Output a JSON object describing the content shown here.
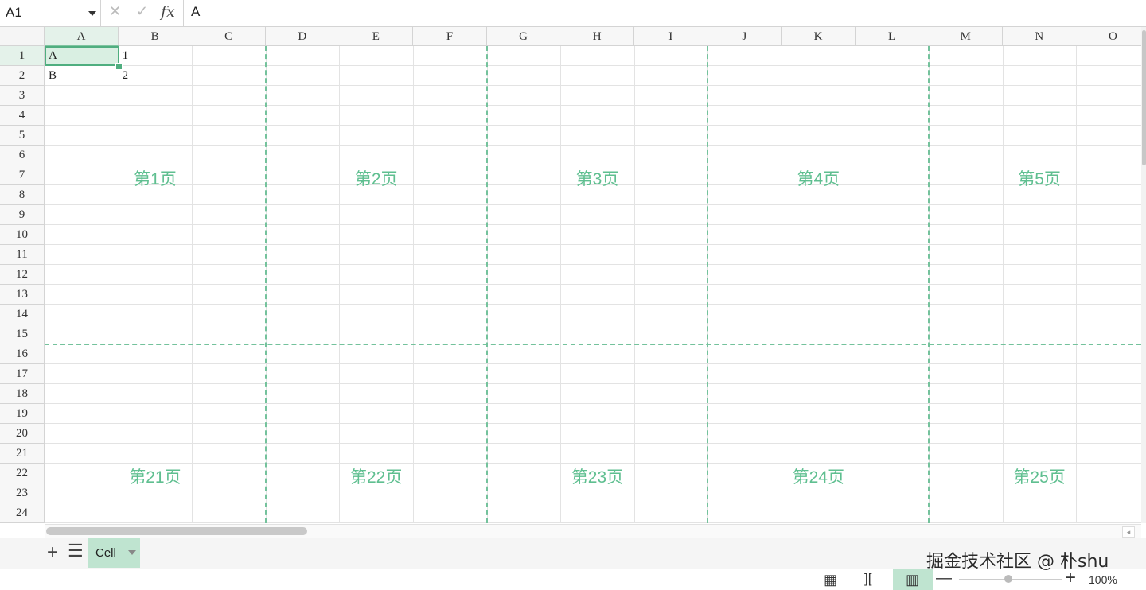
{
  "formula_bar": {
    "name_box": "A1",
    "cancel_glyph": "✕",
    "confirm_glyph": "✓",
    "fx_label": "fx",
    "value": "A"
  },
  "sheet": {
    "columns": [
      "A",
      "B",
      "C",
      "D",
      "E",
      "F",
      "G",
      "H",
      "I",
      "J",
      "K",
      "L",
      "M",
      "N",
      "O"
    ],
    "rows": [
      "1",
      "2",
      "3",
      "4",
      "5",
      "6",
      "7",
      "8",
      "9",
      "10",
      "11",
      "12",
      "13",
      "14",
      "15",
      "16",
      "17",
      "18",
      "19",
      "20",
      "21",
      "22",
      "23",
      "24"
    ],
    "selected_column": "A",
    "selected_row": "1",
    "cells": {
      "A1": "A",
      "B1": "1",
      "A2": "B",
      "B2": "2"
    },
    "page_labels": [
      "第1页",
      "第2页",
      "第3页",
      "第4页",
      "第5页",
      "第21页",
      "第22页",
      "第23页",
      "第24页",
      "第25页"
    ],
    "page_break_color": "#74c29c",
    "accent_color": "#4fae7f"
  },
  "tabs": {
    "add_glyph": "+",
    "list_glyph": "☰",
    "sheet_name": "Cell"
  },
  "status": {
    "zoom_minus": "—",
    "zoom_plus": "+",
    "zoom": "100%"
  },
  "watermark": "掘金技术社区 @ 朴shu"
}
